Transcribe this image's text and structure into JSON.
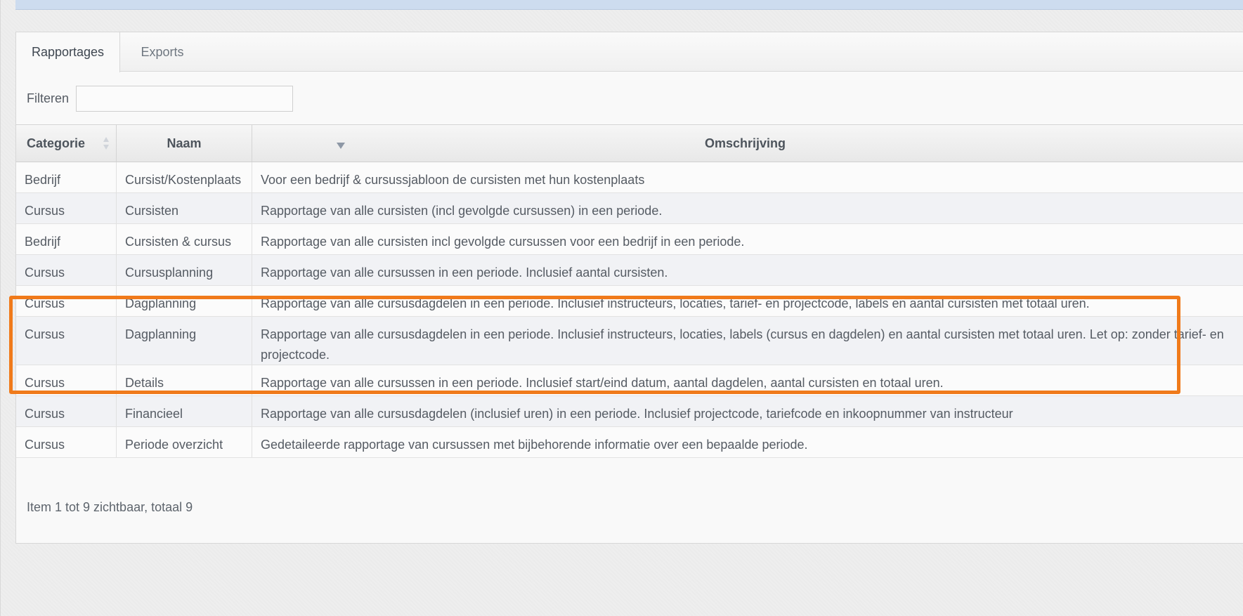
{
  "tabs": [
    {
      "label": "Rapportages",
      "active": true
    },
    {
      "label": "Exports",
      "active": false
    }
  ],
  "filter": {
    "label": "Filteren",
    "value": "",
    "placeholder": ""
  },
  "table": {
    "headers": {
      "category": "Categorie",
      "name": "Naam",
      "description": "Omschrijving"
    },
    "sort": {
      "category": "none",
      "name": "descending"
    },
    "rows": [
      {
        "category": "Bedrijf",
        "name": "Cursist/Kostenplaats",
        "description": "Voor een bedrijf & cursussjabloon de cursisten met hun kostenplaats"
      },
      {
        "category": "Cursus",
        "name": "Cursisten",
        "description": "Rapportage van alle cursisten (incl gevolgde cursussen) in een periode."
      },
      {
        "category": "Bedrijf",
        "name": "Cursisten & cursus",
        "description": "Rapportage van alle cursisten incl gevolgde cursussen voor een bedrijf in een periode."
      },
      {
        "category": "Cursus",
        "name": "Cursusplanning",
        "description": "Rapportage van alle cursussen in een periode. Inclusief aantal cursisten."
      },
      {
        "category": "Cursus",
        "name": "Dagplanning",
        "description": "Rapportage van alle cursusdagdelen in een periode. Inclusief instructeurs, locaties, tarief- en projectcode, labels en aantal cursisten met totaal uren."
      },
      {
        "category": "Cursus",
        "name": "Dagplanning",
        "description": "Rapportage van alle cursusdagdelen in een periode. Inclusief instructeurs, locaties, labels (cursus en dagdelen) en aantal cursisten met totaal uren. Let op: zonder tarief- en projectcode."
      },
      {
        "category": "Cursus",
        "name": "Details",
        "description": "Rapportage van alle cursussen in een periode. Inclusief start/eind datum, aantal dagdelen, aantal cursisten en totaal uren."
      },
      {
        "category": "Cursus",
        "name": "Financieel",
        "description": "Rapportage van alle cursusdagdelen (inclusief uren) in een periode. Inclusief projectcode, tariefcode en inkoopnummer van instructeur"
      },
      {
        "category": "Cursus",
        "name": "Periode overzicht",
        "description": "Gedetaileerde rapportage van cursussen met bijbehorende informatie over een bepaalde periode."
      }
    ]
  },
  "pager": {
    "text": "Item 1 tot 9 zichtbaar, totaal 9"
  },
  "colors": {
    "highlight": "#f07a1a",
    "top_bar": "#cddcef",
    "row_alt": "#f1f2f5"
  }
}
